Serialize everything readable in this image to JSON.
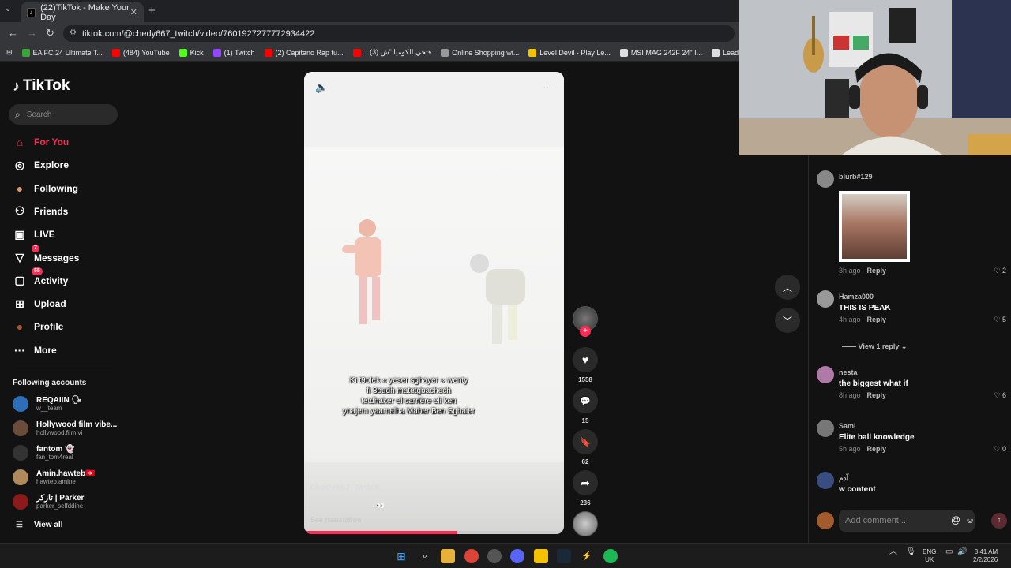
{
  "browser": {
    "tab_title": "(22)TikTok - Make Your Day",
    "tab_close": "✕",
    "new_tab": "+",
    "url": "tiktok.com/@chedy667_twitch/video/7601927277772934422",
    "bookmarks": [
      {
        "label": "EA FC 24 Ultimate T...",
        "color": "#3aa43a"
      },
      {
        "label": "(484) YouTube",
        "color": "#ff0000"
      },
      {
        "label": "Kick",
        "color": "#53fc18"
      },
      {
        "label": "(1) Twitch",
        "color": "#9146ff"
      },
      {
        "label": "(2) Capitano Rap tu...",
        "color": "#ff0000"
      },
      {
        "label": "...فتحي الكوميا \"ش (3)",
        "color": "#ff0000"
      },
      {
        "label": "Online Shopping wi...",
        "color": "#999999"
      },
      {
        "label": "Level Devil - Play Le...",
        "color": "#f2c200"
      },
      {
        "label": "MSI MAG 242F 24\" I...",
        "color": "#dddddd"
      },
      {
        "label": "Leading Digital Stor...",
        "color": "#dddddd"
      }
    ]
  },
  "sidebar": {
    "logo": "TikTok",
    "search_placeholder": "Search",
    "nav": [
      {
        "label": "For You",
        "icon": "⌂",
        "icon_name": "home-icon",
        "active": true
      },
      {
        "label": "Explore",
        "icon": "◎",
        "icon_name": "compass-icon"
      },
      {
        "label": "Following",
        "icon": "●",
        "icon_name": "following-avatar-icon"
      },
      {
        "label": "Friends",
        "icon": "⚇",
        "icon_name": "friends-icon"
      },
      {
        "label": "LIVE",
        "icon": "▣",
        "icon_name": "live-icon"
      },
      {
        "label": "Messages",
        "icon": "▽",
        "icon_name": "messages-icon",
        "badge": "7"
      },
      {
        "label": "Activity",
        "icon": "▢",
        "icon_name": "activity-icon",
        "badge": "55"
      },
      {
        "label": "Upload",
        "icon": "⊞",
        "icon_name": "upload-icon"
      },
      {
        "label": "Profile",
        "icon": "●",
        "icon_name": "profile-avatar-icon"
      },
      {
        "label": "More",
        "icon": "···",
        "icon_name": "more-icon"
      }
    ],
    "following_title": "Following accounts",
    "accounts": [
      {
        "name": "REQAIIN 🗣",
        "handle": "w__team",
        "color": "#2c6fb8"
      },
      {
        "name": "Hollywood film vibe...",
        "handle": "hollywood.film.vi",
        "color": "#6b4c3b"
      },
      {
        "name": "fantom 👻",
        "handle": "fan_tom4real",
        "color": "#333333"
      },
      {
        "name": "Amin.hawteb🇹🇳",
        "handle": "hawteb.amine",
        "color": "#b08a5a"
      },
      {
        "name": "تازكر | Parker",
        "handle": "parker_selfddine",
        "color": "#8b1a1a"
      }
    ],
    "view_all": "View all"
  },
  "video": {
    "caption_lines": [
      "Ki t9olek « yeser sghayer » wenty",
      "fi 3oudh matetgbachech",
      "tetdhaker el carrière eli ken",
      "ynajem yaamelha Maher Ben Sghaier"
    ],
    "username": "chedy667_twitch",
    "description": "S3iba chwaya hedhi 👀",
    "hashtag": "#touness",
    "see_translation": "See translation",
    "progress": 0.59,
    "mute_icon": "🔈",
    "more_icon": "···"
  },
  "actions": {
    "likes": "1558",
    "comments": "15",
    "saves": "62",
    "shares": "236",
    "follow_plus": "+",
    "like_icon": "♥",
    "comment_icon": "💬",
    "save_icon": "🔖",
    "share_icon": "➦"
  },
  "nav_arrows": {
    "up": "︿",
    "down": "﹀"
  },
  "comments": [
    {
      "user": "blurb#129",
      "text": "",
      "time": "3h ago",
      "reply": "Reply",
      "likes": "2",
      "has_sticker": true,
      "avatar_color": "#888888"
    },
    {
      "user": "Hamza000",
      "text": "THIS IS PEAK",
      "time": "4h ago",
      "reply": "Reply",
      "likes": "5",
      "avatar_color": "#999999"
    },
    {
      "user": "nesta",
      "text": "the biggest what if",
      "time": "8h ago",
      "reply": "Reply",
      "likes": "6",
      "avatar_color": "#b07aa8"
    },
    {
      "user": "Sami",
      "text": "Elite ball knowledge",
      "time": "5h ago",
      "reply": "Reply",
      "likes": "0",
      "avatar_color": "#777777"
    },
    {
      "user": "آدم",
      "text": "w content",
      "time": "",
      "reply": "",
      "likes": "",
      "avatar_color": "#3a4d80"
    }
  ],
  "view_replies": "View 1 reply",
  "add_comment_placeholder": "Add comment...",
  "taskbar": {
    "lang_top": "ENG",
    "lang_bottom": "UK",
    "time": "3:41 AM",
    "date": "2/2/2026"
  }
}
